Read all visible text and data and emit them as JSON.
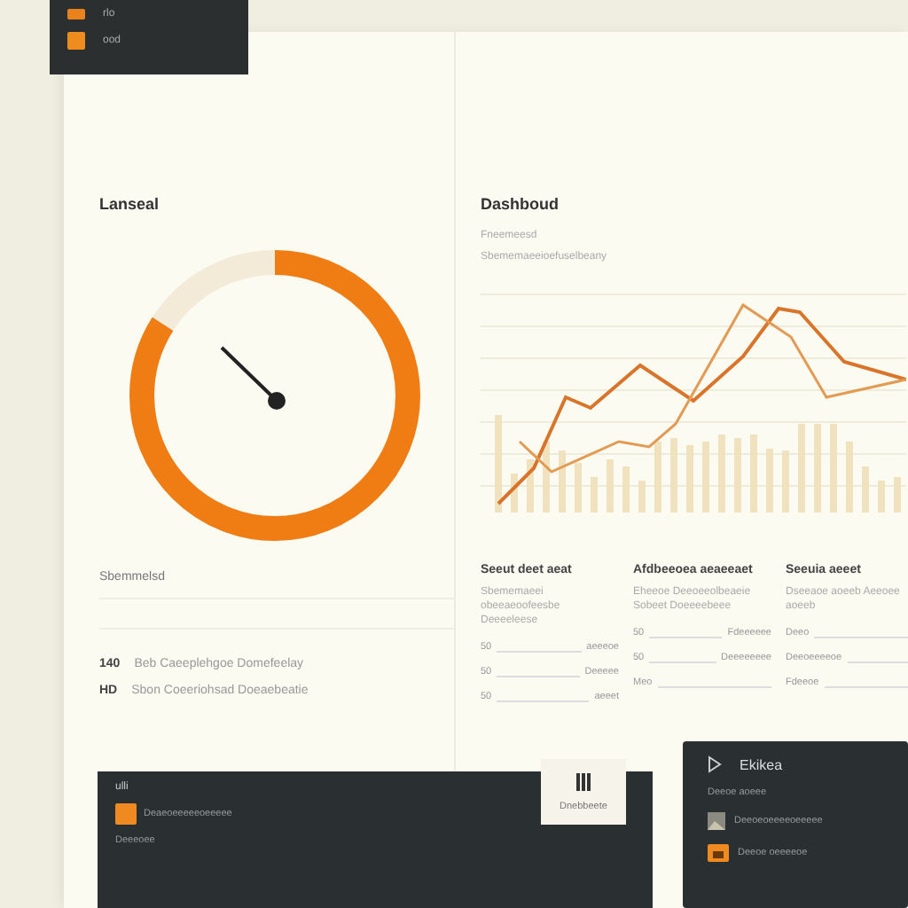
{
  "top_menu": {
    "items": [
      {
        "label": "rlo",
        "kind": "small"
      },
      {
        "label": "ood",
        "kind": "box"
      }
    ]
  },
  "left_panel": {
    "title": "Lanseal",
    "gauge": {
      "level": 0.84
    },
    "section_label": "Sbemmelsd",
    "rows": [
      {
        "code": "140",
        "text": "Beb Caeeplehgoe Domefeelay"
      },
      {
        "code": "HD",
        "text": "Sbon Coeeriohsad Doeaebeatie"
      }
    ]
  },
  "right_panel": {
    "title": "Dashboud",
    "subtitle": "Fneemeesd",
    "caption": "Sbememaeeioefuselbeany",
    "columns": [
      {
        "title": "Seeut deet aeat",
        "description": "Sbememaeei obeeaeoofeesbe Deeeeleese",
        "rows": [
          {
            "label": "50",
            "value": "aeeeoe"
          },
          {
            "label": "50",
            "value": "Deeeee"
          },
          {
            "label": "50",
            "value": "aeeet"
          }
        ]
      },
      {
        "title": "Afdbeeoea aeaeeaet",
        "description": "Eheeoe Deeoeeolbeaeie Sobeet Doeeeebeee",
        "rows": [
          {
            "label": "50",
            "value": "Fdeeeeee"
          },
          {
            "label": "50",
            "value": "Deeeeeeee"
          },
          {
            "label": "Meo"
          }
        ]
      },
      {
        "title": "Seeuia aeeet",
        "description": "Dseeaoe aoeeb Aeeoee aoeeb",
        "rows": [
          {
            "label": "Deeo"
          },
          {
            "label": "Deeoeeeeoe"
          },
          {
            "label": "Fdeeoe"
          }
        ]
      }
    ]
  },
  "popup_card": {
    "label": "Dnebbeete"
  },
  "bottom_panel": {
    "tab": "ulli",
    "items": [
      {
        "text": "Deaeoeeeeeoeeeee",
        "kind": "file"
      },
      {
        "text": "Deeeoee",
        "kind": "plain"
      }
    ]
  },
  "side_panel": {
    "title": "Ekikea",
    "items": [
      {
        "text": "Deeoe aoeee",
        "kind": "plain"
      },
      {
        "text": "Deeoeoeeeeoeeeee",
        "kind": "image"
      },
      {
        "text": "Deeoe oeeeeoe",
        "kind": "folder"
      }
    ]
  }
}
